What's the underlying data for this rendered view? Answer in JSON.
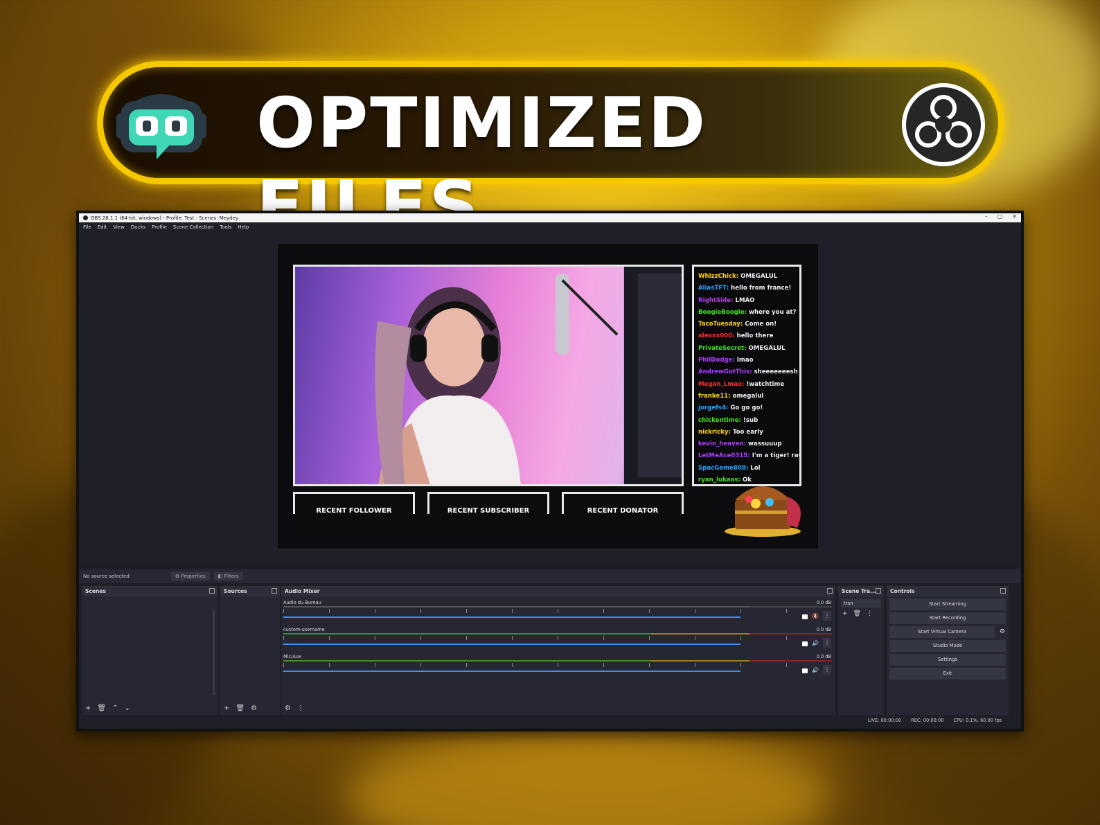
{
  "banner": {
    "title": "OPTIMIZED FILES",
    "left_logo": "streamlabs-logo-icon",
    "right_logo": "obs-logo-icon"
  },
  "window": {
    "title": "OBS 28.1.1 (64-bit, windows) - Profile: Test - Scenes: Meydey",
    "controls": [
      "–",
      "▢",
      "✕"
    ],
    "menu": [
      "File",
      "Edit",
      "View",
      "Docks",
      "Profile",
      "Scene Collection",
      "Tools",
      "Help"
    ]
  },
  "overlay": {
    "chat": [
      {
        "name": "WhizzChick",
        "color": "#ffd400",
        "msg": "OMEGALUL"
      },
      {
        "name": "AliasTFT",
        "color": "#2aa4ff",
        "msg": "hello from france!"
      },
      {
        "name": "RightSide",
        "color": "#b03cff",
        "msg": "LMAO"
      },
      {
        "name": "BoogieBoogie",
        "color": "#43e01b",
        "msg": "where you at?"
      },
      {
        "name": "TacoTuesday",
        "color": "#ffd400",
        "msg": "Come on!"
      },
      {
        "name": "alexxx000",
        "color": "#ff2b2b",
        "msg": "hello there"
      },
      {
        "name": "PrivateSecret",
        "color": "#43e01b",
        "msg": "OMEGALUL"
      },
      {
        "name": "PhilDodge",
        "color": "#b03cff",
        "msg": "lmao"
      },
      {
        "name": "AndrewGotThis",
        "color": "#b03cff",
        "msg": "sheeeeeeesh"
      },
      {
        "name": "Megan_Lmao",
        "color": "#ff2b2b",
        "msg": "!watchtime"
      },
      {
        "name": "franke11",
        "color": "#ffd400",
        "msg": "omegalul"
      },
      {
        "name": "jorgefs4",
        "color": "#2aa4ff",
        "msg": "Go go go!"
      },
      {
        "name": "chickentime",
        "color": "#43e01b",
        "msg": "!sub"
      },
      {
        "name": "nickricky",
        "color": "#ffd400",
        "msg": "Too early"
      },
      {
        "name": "kevin_heaven",
        "color": "#b03cff",
        "msg": "wassuuup"
      },
      {
        "name": "LetMeAce0315",
        "color": "#b03cff",
        "msg": "I'm a tiger! rawr!"
      },
      {
        "name": "SpacGame808",
        "color": "#2aa4ff",
        "msg": "Lol"
      },
      {
        "name": "ryan_lukaas",
        "color": "#43e01b",
        "msg": "Ok"
      }
    ],
    "placeholders": [
      "RECENT FOLLOWER",
      "RECENT SUBSCRIBER",
      "RECENT DONATOR"
    ]
  },
  "source_bar": {
    "status": "No source selected",
    "properties": "Properties",
    "filters": "Filters"
  },
  "docks": {
    "scenes": "Scenes",
    "sources": "Sources",
    "audio_mixer": "Audio Mixer",
    "scene_transitions": "Scene Tra...",
    "controls": "Controls",
    "transition_value": "tran"
  },
  "audio": [
    {
      "name": "Audio du Bureau",
      "db": "0.0 dB",
      "level": 0.86
    },
    {
      "name": "custom-username",
      "db": "0.0 dB",
      "level": 0.86
    },
    {
      "name": "Mic/Aux",
      "db": "0.0 dB",
      "level": 0.86
    }
  ],
  "controls": [
    "Start Streaming",
    "Start Recording",
    "Start Virtual Camera",
    "Studio Mode",
    "Settings",
    "Exit"
  ],
  "status": {
    "live": "LIVE: 00:00:00",
    "rec": "REC: 00:00:00",
    "cpu": "CPU: 0.1%, 60.00 fps"
  }
}
